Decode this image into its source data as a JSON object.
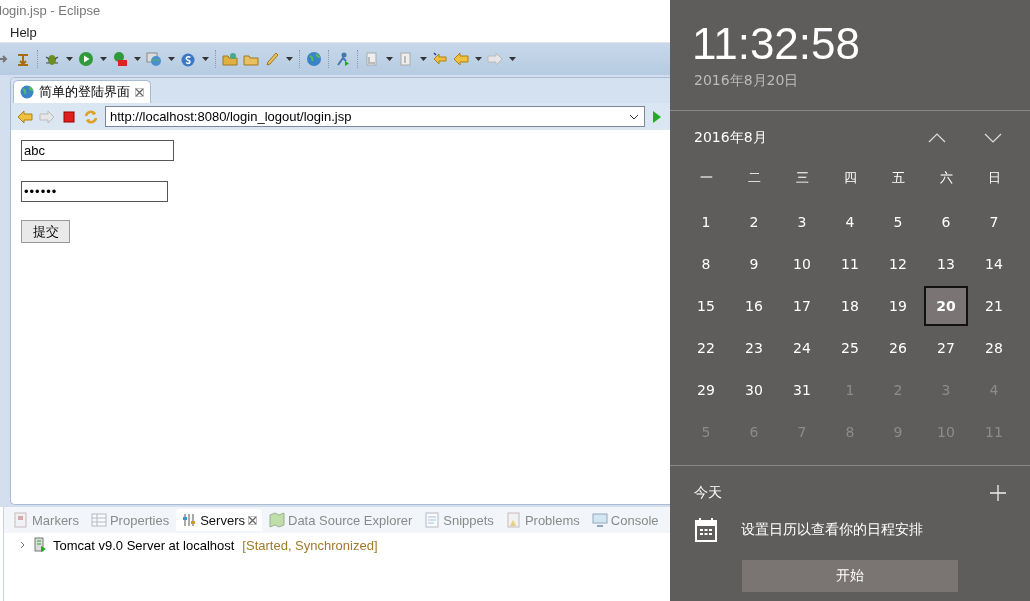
{
  "window": {
    "title": "login.jsp - Eclipse"
  },
  "menu": [
    "Help"
  ],
  "editor": {
    "tab": {
      "label": "简单的登陆界面",
      "selected": true
    },
    "url": "http://localhost:8080/login_logout/login.jsp",
    "form": {
      "username": "abc",
      "password": "••••••",
      "submit": "提交"
    }
  },
  "views": {
    "tabs": [
      {
        "label": "Markers",
        "selected": false
      },
      {
        "label": "Properties",
        "selected": false
      },
      {
        "label": "Servers",
        "selected": true
      },
      {
        "label": "Data Source Explorer",
        "selected": false
      },
      {
        "label": "Snippets",
        "selected": false
      },
      {
        "label": "Problems",
        "selected": false
      },
      {
        "label": "Console",
        "selected": false
      }
    ],
    "servers": [
      {
        "name": "Tomcat v9.0 Server at localhost",
        "status": "[Started, Synchronized]",
        "expanded": false
      }
    ]
  },
  "flyout": {
    "time": "11:32:58",
    "date": "2016年8月20日",
    "month": "2016年8月",
    "weekdays": [
      "一",
      "二",
      "三",
      "四",
      "五",
      "六",
      "日"
    ],
    "days": [
      {
        "label": "1",
        "in_month": true,
        "selected": false
      },
      {
        "label": "2",
        "in_month": true,
        "selected": false
      },
      {
        "label": "3",
        "in_month": true,
        "selected": false
      },
      {
        "label": "4",
        "in_month": true,
        "selected": false
      },
      {
        "label": "5",
        "in_month": true,
        "selected": false
      },
      {
        "label": "6",
        "in_month": true,
        "selected": false
      },
      {
        "label": "7",
        "in_month": true,
        "selected": false
      },
      {
        "label": "8",
        "in_month": true,
        "selected": false
      },
      {
        "label": "9",
        "in_month": true,
        "selected": false
      },
      {
        "label": "10",
        "in_month": true,
        "selected": false
      },
      {
        "label": "11",
        "in_month": true,
        "selected": false
      },
      {
        "label": "12",
        "in_month": true,
        "selected": false
      },
      {
        "label": "13",
        "in_month": true,
        "selected": false
      },
      {
        "label": "14",
        "in_month": true,
        "selected": false
      },
      {
        "label": "15",
        "in_month": true,
        "selected": false
      },
      {
        "label": "16",
        "in_month": true,
        "selected": false
      },
      {
        "label": "17",
        "in_month": true,
        "selected": false
      },
      {
        "label": "18",
        "in_month": true,
        "selected": false
      },
      {
        "label": "19",
        "in_month": true,
        "selected": false
      },
      {
        "label": "20",
        "in_month": true,
        "selected": true
      },
      {
        "label": "21",
        "in_month": true,
        "selected": false
      },
      {
        "label": "22",
        "in_month": true,
        "selected": false
      },
      {
        "label": "23",
        "in_month": true,
        "selected": false
      },
      {
        "label": "24",
        "in_month": true,
        "selected": false
      },
      {
        "label": "25",
        "in_month": true,
        "selected": false
      },
      {
        "label": "26",
        "in_month": true,
        "selected": false
      },
      {
        "label": "27",
        "in_month": true,
        "selected": false
      },
      {
        "label": "28",
        "in_month": true,
        "selected": false
      },
      {
        "label": "29",
        "in_month": true,
        "selected": false
      },
      {
        "label": "30",
        "in_month": true,
        "selected": false
      },
      {
        "label": "31",
        "in_month": true,
        "selected": false
      },
      {
        "label": "1",
        "in_month": false,
        "selected": false
      },
      {
        "label": "2",
        "in_month": false,
        "selected": false
      },
      {
        "label": "3",
        "in_month": false,
        "selected": false
      },
      {
        "label": "4",
        "in_month": false,
        "selected": false
      },
      {
        "label": "5",
        "in_month": false,
        "selected": false
      },
      {
        "label": "6",
        "in_month": false,
        "selected": false
      },
      {
        "label": "7",
        "in_month": false,
        "selected": false
      },
      {
        "label": "8",
        "in_month": false,
        "selected": false
      },
      {
        "label": "9",
        "in_month": false,
        "selected": false
      },
      {
        "label": "10",
        "in_month": false,
        "selected": false
      },
      {
        "label": "11",
        "in_month": false,
        "selected": false
      }
    ],
    "agenda": {
      "heading": "今天",
      "message": "设置日历以查看你的日程安排",
      "button": "开始"
    }
  }
}
